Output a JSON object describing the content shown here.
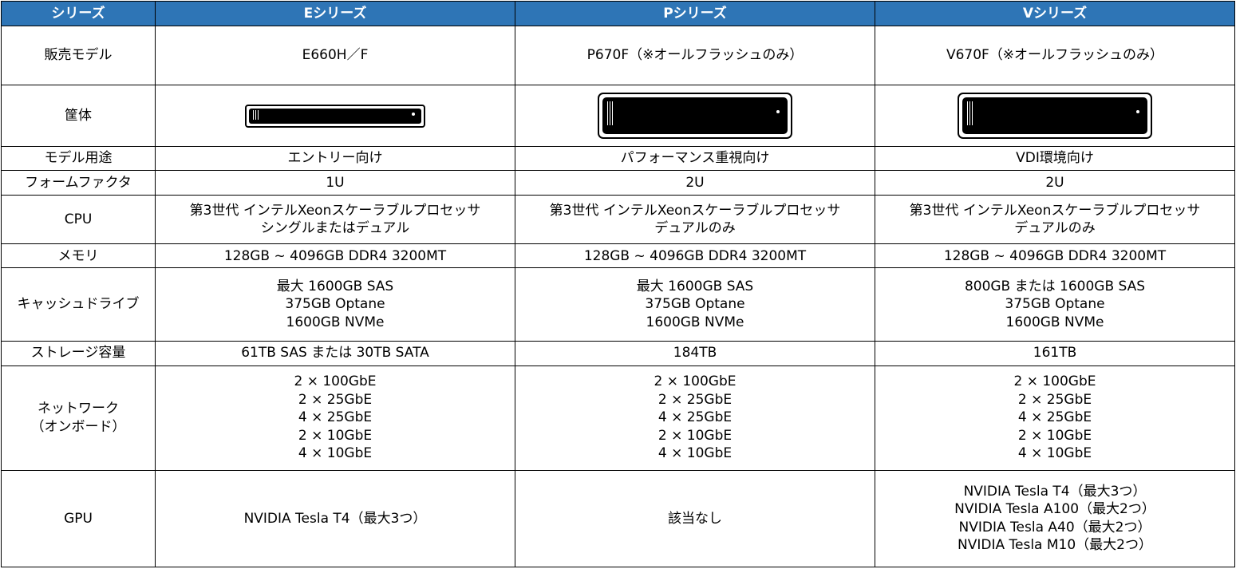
{
  "header": {
    "col0": "シリーズ",
    "col1": "Eシリーズ",
    "col2": "Pシリーズ",
    "col3": "Vシリーズ"
  },
  "rows": {
    "model": {
      "label": "販売モデル",
      "e": "E660H／F",
      "p": "P670F（※オールフラッシュのみ）",
      "v": "V670F（※オールフラッシュのみ）"
    },
    "chassis": {
      "label": "筐体",
      "e_icon": "rack-server-1u-icon",
      "p_icon": "rack-server-2u-icon",
      "v_icon": "rack-server-2u-icon"
    },
    "usage": {
      "label": "モデル用途",
      "e": "エントリー向け",
      "p": "パフォーマンス重視向け",
      "v": "VDI環境向け"
    },
    "form_factor": {
      "label": "フォームファクタ",
      "e": "1U",
      "p": "2U",
      "v": "2U"
    },
    "cpu": {
      "label": "CPU",
      "e": [
        "第3世代 インテルXeonスケーラブルプロセッサ",
        "シングルまたはデュアル"
      ],
      "p": [
        "第3世代 インテルXeonスケーラブルプロセッサ",
        "デュアルのみ"
      ],
      "v": [
        "第3世代 インテルXeonスケーラブルプロセッサ",
        "デュアルのみ"
      ]
    },
    "memory": {
      "label": "メモリ",
      "e": "128GB ~ 4096GB DDR4 3200MT",
      "p": "128GB ~ 4096GB DDR4 3200MT",
      "v": "128GB ~ 4096GB DDR4 3200MT"
    },
    "cache": {
      "label": "キャッシュドライブ",
      "e": [
        "最大 1600GB SAS",
        "375GB Optane",
        "1600GB NVMe"
      ],
      "p": [
        "最大 1600GB SAS",
        "375GB Optane",
        "1600GB NVMe"
      ],
      "v": [
        "800GB または 1600GB SAS",
        "375GB Optane",
        "1600GB NVMe"
      ]
    },
    "storage": {
      "label": "ストレージ容量",
      "e": "61TB SAS または 30TB SATA",
      "p": "184TB",
      "v": "161TB"
    },
    "network": {
      "label": [
        "ネットワーク",
        "（オンボード）"
      ],
      "e": [
        "2 × 100GbE",
        "2 × 25GbE",
        "4 × 25GbE",
        "2 × 10GbE",
        "4 × 10GbE"
      ],
      "p": [
        "2 × 100GbE",
        "2 × 25GbE",
        "4 × 25GbE",
        "2 × 10GbE",
        "4 × 10GbE"
      ],
      "v": [
        "2 × 100GbE",
        "2 × 25GbE",
        "4 × 25GbE",
        "2 × 10GbE",
        "4 × 10GbE"
      ]
    },
    "gpu": {
      "label": "GPU",
      "e": "NVIDIA Tesla T4（最大3つ）",
      "p": "該当なし",
      "v": [
        "NVIDIA Tesla T4（最大3つ）",
        "NVIDIA Tesla A100（最大2つ）",
        "NVIDIA Tesla A40（最大2つ）",
        "NVIDIA Tesla M10（最大2つ）"
      ]
    }
  },
  "colors": {
    "header_bg": "#2e75b6",
    "header_text": "#ffffff",
    "border": "#000000"
  }
}
